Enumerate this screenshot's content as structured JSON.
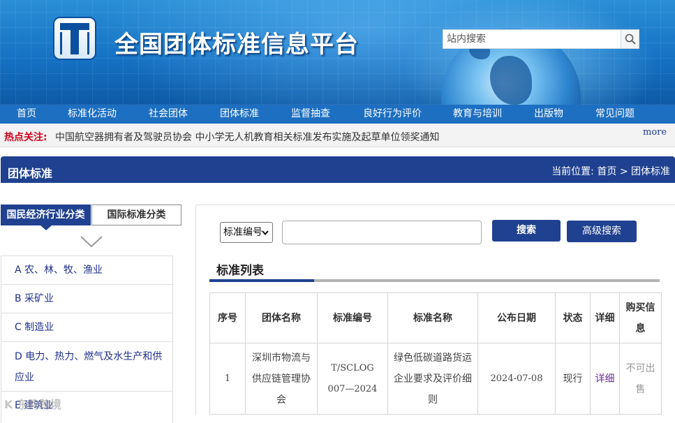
{
  "header": {
    "site_title": "全国团体标准信息平台",
    "search_placeholder": "站内搜索"
  },
  "nav": {
    "items": [
      "首页",
      "标准化活动",
      "社会团体",
      "团体标准",
      "监督抽查",
      "良好行为评价",
      "教育与培训",
      "出版物",
      "常见问题"
    ]
  },
  "hot_news": {
    "label": "热点关注:",
    "text": "中国航空器拥有者及驾驶员协会 中小学无人机教育相关标准发布实施及起草单位领奖通知",
    "more": "more"
  },
  "section": {
    "title": "团体标准",
    "breadcrumb_prefix": "当前位置:",
    "breadcrumb_home": "首页",
    "breadcrumb_sep": ">",
    "breadcrumb_current": "团体标准"
  },
  "left_panel": {
    "tab_active": "国民经济行业分类",
    "tab_inactive": "国际标准分类",
    "categories": [
      "A 农、林、牧、渔业",
      "B 采矿业",
      "C 制造业",
      "D 电力、热力、燃气及水生产和供应业",
      "E 建筑业"
    ]
  },
  "search_form": {
    "select_value": "标准编号",
    "keyword_value": "",
    "search_button": "搜索",
    "advanced_button": "高级搜索"
  },
  "list": {
    "title": "标准列表",
    "columns": [
      "序号",
      "团体名称",
      "标准编号",
      "标准名称",
      "公布日期",
      "状态",
      "详细",
      "购买信息"
    ],
    "rows": [
      {
        "index": "1",
        "org": "深圳市物流与供应链管理协会",
        "code": "T/SCLOG 007—2024",
        "name": "绿色低碳道路货运企业要求及评价细则",
        "date": "2024-07-08",
        "status": "现行",
        "detail": "详细",
        "purchase": "不可出售"
      }
    ]
  },
  "watermark": "K 东购跨境"
}
